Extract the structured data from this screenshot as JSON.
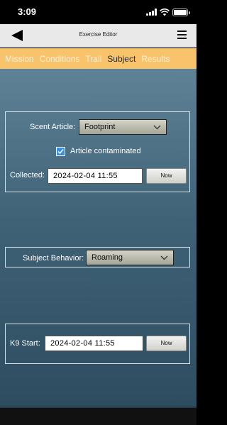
{
  "status": {
    "time": "3:09",
    "battery_percent": 100
  },
  "nav": {
    "title": "Exercise Editor",
    "back_icon": "back-arrow-icon",
    "menu_icon": "hamburger-menu-icon"
  },
  "tabs": [
    {
      "label": "Mission",
      "active": false
    },
    {
      "label": "Conditions",
      "active": false
    },
    {
      "label": "Trail",
      "active": false
    },
    {
      "label": "Subject",
      "active": true
    },
    {
      "label": "Results",
      "active": false
    }
  ],
  "scent": {
    "label": "Scent Article:",
    "value": "Footprint",
    "contaminated_label": "Article contaminated",
    "contaminated_checked": true,
    "collected_label": "Collected:",
    "collected_value": "2024-02-04 11:55",
    "now_label": "Now"
  },
  "behavior": {
    "label": "Subject Behavior:",
    "value": "Roaming"
  },
  "k9": {
    "label": "K9 Start:",
    "value": "2024-02-04 11:55",
    "now_label": "Now"
  }
}
